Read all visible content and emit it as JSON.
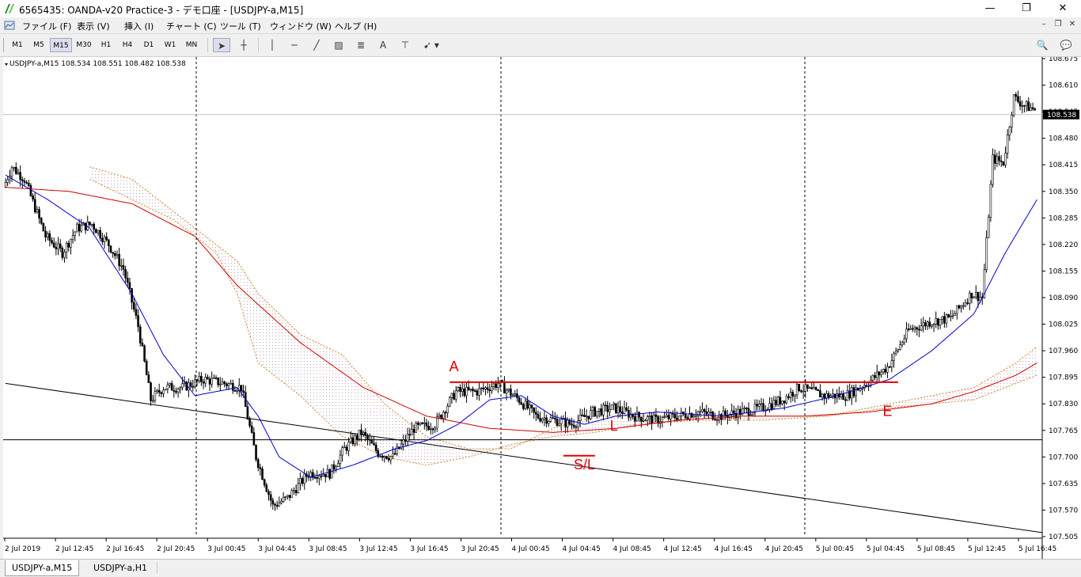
{
  "window": {
    "title": "6565435: OANDA-v20 Practice-3 - デモ口座 - [USDJPY-a,M15]"
  },
  "menu": [
    "ファイル (F)",
    "表示 (V)",
    "挿入 (I)",
    "チャート (C)",
    "ツール (T)",
    "ウィンドウ (W)",
    "ヘルプ (H)"
  ],
  "timeframes": [
    {
      "label": "M1",
      "active": false
    },
    {
      "label": "M5",
      "active": false
    },
    {
      "label": "M15",
      "active": true
    },
    {
      "label": "M30",
      "active": false
    },
    {
      "label": "H1",
      "active": false
    },
    {
      "label": "H4",
      "active": false
    },
    {
      "label": "D1",
      "active": false
    },
    {
      "label": "W1",
      "active": false
    },
    {
      "label": "MN",
      "active": false
    }
  ],
  "chart_info": {
    "symbol_line": "USDJPY-a,M15  108.534 108.551 108.482 108.538"
  },
  "chart_data": {
    "type": "line",
    "ylim": [
      107.505,
      108.675
    ],
    "y_ticks": [
      "108.675",
      "108.610",
      "108.545",
      "108.480",
      "108.415",
      "108.350",
      "108.285",
      "108.220",
      "108.155",
      "108.090",
      "108.025",
      "107.960",
      "107.895",
      "107.830",
      "107.765",
      "107.700",
      "107.635",
      "107.570",
      "107.505"
    ],
    "x_ticks": [
      "2 Jul 2019",
      "2 Jul 12:45",
      "2 Jul 16:45",
      "2 Jul 20:45",
      "3 Jul 00:45",
      "3 Jul 04:45",
      "3 Jul 08:45",
      "3 Jul 12:45",
      "3 Jul 16:45",
      "3 Jul 20:45",
      "4 Jul 00:45",
      "4 Jul 04:45",
      "4 Jul 08:45",
      "4 Jul 12:45",
      "4 Jul 16:45",
      "4 Jul 20:45",
      "5 Jul 00:45",
      "5 Jul 04:45",
      "5 Jul 08:45",
      "5 Jul 12:45",
      "5 Jul 16:45"
    ],
    "current_price": "108.538",
    "bars": 400,
    "anchors": [
      [
        0,
        108.36
      ],
      [
        4,
        108.41
      ],
      [
        10,
        108.38
      ],
      [
        20,
        108.24
      ],
      [
        28,
        108.2
      ],
      [
        35,
        108.26
      ],
      [
        42,
        108.27
      ],
      [
        50,
        108.22
      ],
      [
        57,
        108.16
      ],
      [
        64,
        108.02
      ],
      [
        70,
        107.84
      ],
      [
        76,
        107.87
      ],
      [
        85,
        107.87
      ],
      [
        95,
        107.89
      ],
      [
        105,
        107.88
      ],
      [
        113,
        107.87
      ],
      [
        120,
        107.7
      ],
      [
        128,
        107.58
      ],
      [
        135,
        107.6
      ],
      [
        145,
        107.66
      ],
      [
        155,
        107.66
      ],
      [
        162,
        107.72
      ],
      [
        170,
        107.76
      ],
      [
        178,
        107.71
      ],
      [
        185,
        107.7
      ],
      [
        195,
        107.77
      ],
      [
        205,
        107.78
      ],
      [
        215,
        107.86
      ],
      [
        225,
        107.86
      ],
      [
        235,
        107.88
      ],
      [
        245,
        107.84
      ],
      [
        253,
        107.8
      ],
      [
        262,
        107.79
      ],
      [
        270,
        107.78
      ],
      [
        280,
        107.81
      ],
      [
        290,
        107.82
      ],
      [
        300,
        107.8
      ],
      [
        310,
        107.79
      ],
      [
        320,
        107.8
      ],
      [
        330,
        107.81
      ],
      [
        340,
        107.8
      ],
      [
        350,
        107.81
      ],
      [
        360,
        107.82
      ],
      [
        370,
        107.84
      ],
      [
        378,
        107.87
      ],
      [
        390,
        107.85
      ],
      [
        400,
        107.85
      ],
      [
        410,
        107.88
      ],
      [
        420,
        107.92
      ],
      [
        430,
        108.01
      ],
      [
        440,
        108.03
      ],
      [
        450,
        108.04
      ],
      [
        460,
        108.1
      ],
      [
        465,
        108.09
      ],
      [
        470,
        108.43
      ],
      [
        475,
        108.42
      ],
      [
        480,
        108.58
      ],
      [
        485,
        108.56
      ],
      [
        490,
        108.55
      ]
    ],
    "ma_blue": [
      [
        0,
        108.39
      ],
      [
        20,
        108.33
      ],
      [
        40,
        108.26
      ],
      [
        60,
        108.1
      ],
      [
        75,
        107.95
      ],
      [
        90,
        107.85
      ],
      [
        110,
        107.87
      ],
      [
        120,
        107.8
      ],
      [
        130,
        107.7
      ],
      [
        145,
        107.65
      ],
      [
        165,
        107.68
      ],
      [
        185,
        107.72
      ],
      [
        200,
        107.74
      ],
      [
        215,
        107.78
      ],
      [
        230,
        107.84
      ],
      [
        245,
        107.85
      ],
      [
        260,
        107.8
      ],
      [
        275,
        107.78
      ],
      [
        290,
        107.8
      ],
      [
        310,
        107.81
      ],
      [
        340,
        107.8
      ],
      [
        370,
        107.82
      ],
      [
        395,
        107.85
      ],
      [
        420,
        107.89
      ],
      [
        440,
        107.96
      ],
      [
        460,
        108.05
      ],
      [
        475,
        108.2
      ],
      [
        490,
        108.33
      ]
    ],
    "ma_red": [
      [
        0,
        108.36
      ],
      [
        30,
        108.35
      ],
      [
        60,
        108.32
      ],
      [
        90,
        108.24
      ],
      [
        110,
        108.12
      ],
      [
        140,
        107.98
      ],
      [
        170,
        107.87
      ],
      [
        200,
        107.8
      ],
      [
        230,
        107.77
      ],
      [
        260,
        107.76
      ],
      [
        290,
        107.77
      ],
      [
        320,
        107.79
      ],
      [
        350,
        107.8
      ],
      [
        380,
        107.8
      ],
      [
        410,
        107.81
      ],
      [
        440,
        107.83
      ],
      [
        460,
        107.86
      ],
      [
        480,
        107.9
      ],
      [
        490,
        107.93
      ]
    ],
    "cloud_a": [
      [
        40,
        108.41
      ],
      [
        60,
        108.38
      ],
      [
        80,
        108.3
      ],
      [
        100,
        108.22
      ],
      [
        110,
        108.18
      ],
      [
        120,
        108.1
      ],
      [
        140,
        108
      ],
      [
        160,
        107.95
      ],
      [
        180,
        107.83
      ],
      [
        200,
        107.75
      ],
      [
        220,
        107.72
      ],
      [
        240,
        107.72
      ],
      [
        260,
        107.77
      ],
      [
        280,
        107.8
      ],
      [
        300,
        107.8
      ],
      [
        330,
        107.8
      ],
      [
        360,
        107.8
      ],
      [
        390,
        107.8
      ],
      [
        420,
        107.83
      ],
      [
        440,
        107.85
      ],
      [
        460,
        107.87
      ],
      [
        480,
        107.93
      ],
      [
        490,
        107.97
      ]
    ],
    "cloud_b": [
      [
        40,
        108.38
      ],
      [
        60,
        108.33
      ],
      [
        80,
        108.28
      ],
      [
        100,
        108.2
      ],
      [
        110,
        108.1
      ],
      [
        120,
        107.93
      ],
      [
        140,
        107.85
      ],
      [
        160,
        107.75
      ],
      [
        180,
        107.7
      ],
      [
        200,
        107.68
      ],
      [
        220,
        107.7
      ],
      [
        240,
        107.73
      ],
      [
        260,
        107.75
      ],
      [
        280,
        107.76
      ],
      [
        300,
        107.78
      ],
      [
        330,
        107.79
      ],
      [
        360,
        107.79
      ],
      [
        390,
        107.8
      ],
      [
        420,
        107.82
      ],
      [
        440,
        107.83
      ],
      [
        460,
        107.84
      ],
      [
        480,
        107.88
      ],
      [
        490,
        107.9
      ]
    ],
    "trendline": [
      [
        0,
        107.88
      ],
      [
        490,
        107.515
      ]
    ],
    "hline": 107.742,
    "resistance": {
      "from": 211,
      "to": 424,
      "y": 107.883
    },
    "stoploss": {
      "from": 265,
      "to": 280,
      "y": 107.703
    },
    "annotations": [
      {
        "text": "A",
        "bar": 213,
        "y": 107.91
      },
      {
        "text": "L",
        "bar": 289,
        "y": 107.765
      },
      {
        "text": "S/L",
        "bar": 275,
        "y": 107.67
      },
      {
        "text": "E",
        "bar": 419,
        "y": 107.8
      }
    ]
  },
  "tabs": [
    {
      "label": "USDJPY-a,M15",
      "active": true
    },
    {
      "label": "USDJPY-a,H1",
      "active": false
    }
  ],
  "colors": {
    "bull": "#ffffff",
    "bear": "#000000",
    "ma_blue": "#0000cc",
    "ma_red": "#d00000",
    "cloud": "#d0802a",
    "annot": "#e00000"
  }
}
